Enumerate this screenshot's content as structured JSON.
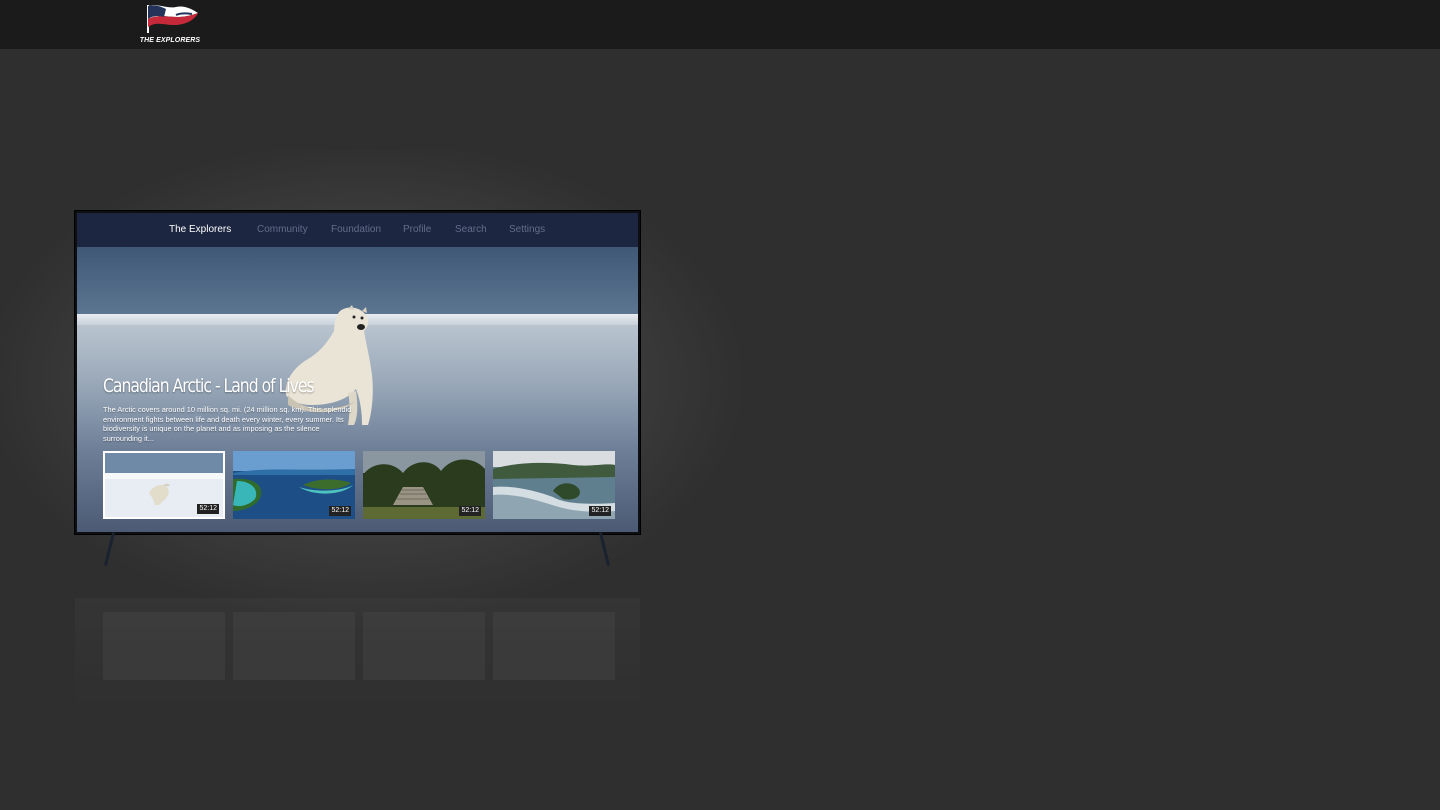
{
  "brand": {
    "name": "THE EXPLORERS"
  },
  "tv": {
    "nav": [
      {
        "label": "The Explorers",
        "active": true
      },
      {
        "label": "Community",
        "active": false
      },
      {
        "label": "Foundation",
        "active": false
      },
      {
        "label": "Profile",
        "active": false
      },
      {
        "label": "Search",
        "active": false
      },
      {
        "label": "Settings",
        "active": false
      }
    ],
    "hero": {
      "title": "Canadian Arctic - Land of Lives",
      "description": "The Arctic covers around 10 million sq. mi. (24 million sq. km). This splendid environment fights between life and death every winter, every summer. Its biodiversity is unique on the planet and as imposing as the silence surrounding it..."
    },
    "thumbnails": [
      {
        "duration": "52:12",
        "selected": true
      },
      {
        "duration": "52:12",
        "selected": false
      },
      {
        "duration": "52:12",
        "selected": false
      },
      {
        "duration": "52:12",
        "selected": false
      }
    ]
  },
  "colors": {
    "page_bg": "#2f2f2f",
    "top_bar": "#1b1b1b",
    "tv_nav_bg": "#1d2640",
    "nav_inactive": "#5f6e8a",
    "nav_active": "#ffffff"
  }
}
